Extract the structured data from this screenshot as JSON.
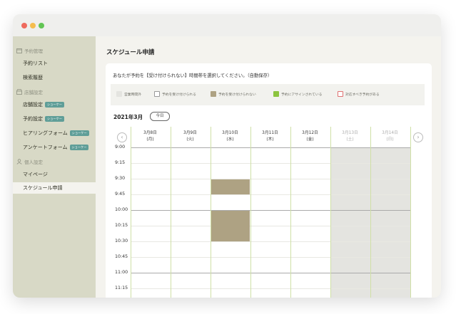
{
  "window": {
    "dots": [
      "#ee6a5e",
      "#f5bd4f",
      "#62c554"
    ]
  },
  "sidebar": {
    "sections": [
      {
        "icon": "calendar-icon",
        "label": "予約管理",
        "items": [
          {
            "label": "予約リスト",
            "badge": ""
          },
          {
            "label": "検索履歴",
            "badge": ""
          }
        ]
      },
      {
        "icon": "store-icon",
        "label": "店舗設定",
        "items": [
          {
            "label": "店舗設定",
            "badge": "ショーケー"
          },
          {
            "label": "予約設定",
            "badge": "ショーケー"
          },
          {
            "label": "ヒアリングフォーム",
            "badge": "ショーケー"
          },
          {
            "label": "アンケートフォーム",
            "badge": "ショーケー"
          }
        ]
      },
      {
        "icon": "person-icon",
        "label": "個人設定",
        "items": [
          {
            "label": "マイページ",
            "badge": ""
          },
          {
            "label": "スケジュール申請",
            "badge": "",
            "active": true
          }
        ]
      }
    ]
  },
  "main": {
    "title": "スケジュール申請",
    "instruction": "あなたが予約を【受け付けられない】時間帯を選択してください。（自動保存）",
    "legend": [
      {
        "label": "営業時間外",
        "color": "#e4e4e0",
        "border": "#e4e4e0"
      },
      {
        "label": "予約を受け付けられる",
        "color": "#ffffff",
        "border": "#999999"
      },
      {
        "label": "予約を受け付けられない",
        "color": "#aea283",
        "border": "#aea283"
      },
      {
        "label": "予約にアサインされている",
        "color": "#8cc43f",
        "border": "#8cc43f"
      },
      {
        "label": "対応すべき予約がある",
        "color": "#ffffff",
        "border": "#e07070"
      }
    ],
    "month": "2021年3月",
    "today_button": "今日",
    "prev_icon": "‹",
    "next_icon": "›",
    "days": [
      {
        "date": "3月8日",
        "weekday": "(月)",
        "off": false
      },
      {
        "date": "3月9日",
        "weekday": "(火)",
        "off": false
      },
      {
        "date": "3月10日",
        "weekday": "(水)",
        "off": false
      },
      {
        "date": "3月11日",
        "weekday": "(木)",
        "off": false
      },
      {
        "date": "3月12日",
        "weekday": "(金)",
        "off": false
      },
      {
        "date": "3月13日",
        "weekday": "(土)",
        "off": true
      },
      {
        "date": "3月14日",
        "weekday": "(日)",
        "off": true
      }
    ],
    "times": [
      "9:00",
      "9:15",
      "9:30",
      "9:45",
      "10:00",
      "10:15",
      "10:30",
      "10:45",
      "11:00",
      "11:15"
    ],
    "unavailable_blocks": [
      {
        "day": 2,
        "start": 2,
        "end": 3
      },
      {
        "day": 2,
        "start": 4,
        "end": 6
      }
    ]
  }
}
